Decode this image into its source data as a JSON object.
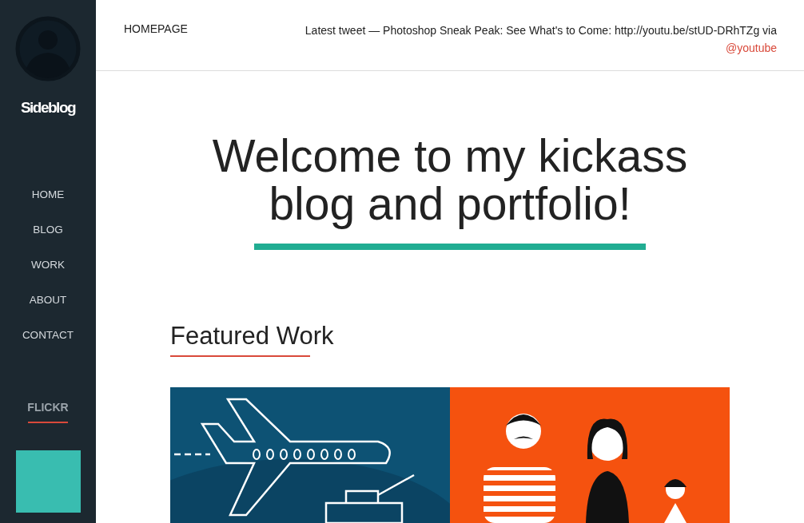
{
  "sidebar": {
    "site_title": "Sideblog",
    "nav": [
      {
        "label": "HOME"
      },
      {
        "label": "BLOG"
      },
      {
        "label": "WORK"
      },
      {
        "label": "ABOUT"
      },
      {
        "label": "CONTACT"
      }
    ],
    "flickr": {
      "heading": "FLICKR"
    }
  },
  "header": {
    "link": "HOMEPAGE",
    "tweet": "Latest tweet — Photoshop Sneak Peak: See What's to Come: http://youtu.be/stUD-DRhTZg via",
    "tweet_handle": "@youtube"
  },
  "hero": {
    "title": "Welcome to my kickass blog and portfolio!"
  },
  "featured": {
    "heading": "Featured Work",
    "items": [
      {
        "kind": "travel"
      },
      {
        "kind": "family"
      }
    ]
  }
}
